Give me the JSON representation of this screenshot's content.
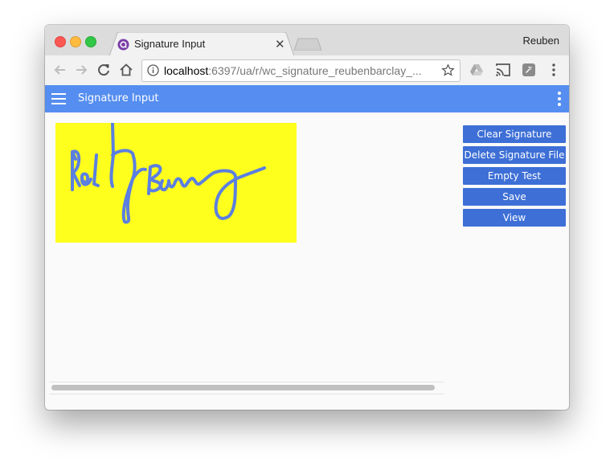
{
  "browser": {
    "tab_title": "Signature Input",
    "profile_name": "Reuben",
    "url_host": "localhost",
    "url_rest": ":6397/ua/r/wc_signature_reubenbarclay_..."
  },
  "app": {
    "title": "Signature Input"
  },
  "signature": {
    "pad_color": "#ffff1e",
    "stroke_color": "#5b7fe0"
  },
  "buttons": {
    "clear": "Clear Signature",
    "delete": "Delete Signature File",
    "empty_test": "Empty Test",
    "save": "Save",
    "view": "View"
  },
  "colors": {
    "app_bar": "#558ef0",
    "button": "#3d6fd6"
  }
}
